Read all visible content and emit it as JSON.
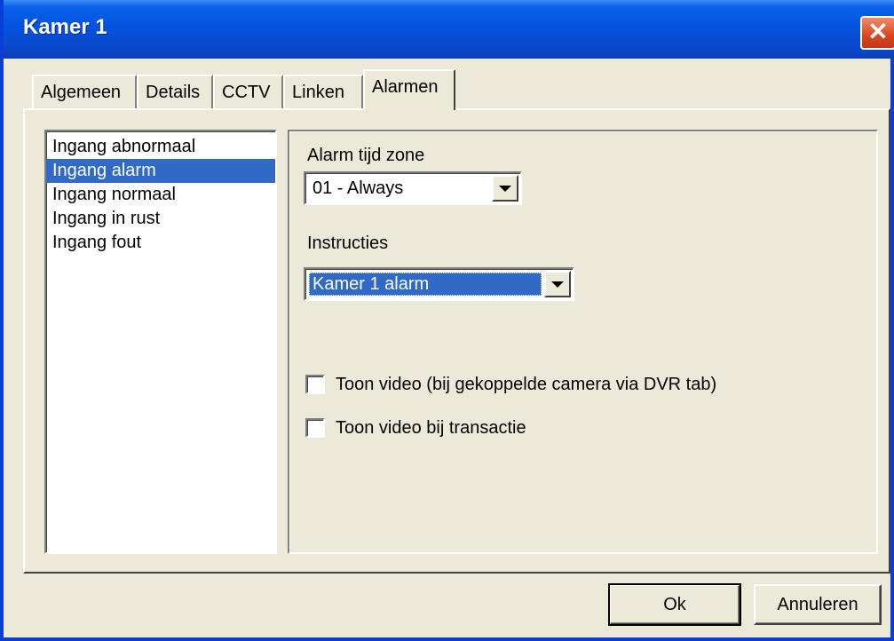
{
  "window": {
    "title": "Kamer 1",
    "close_symbol": "✕"
  },
  "tabs": [
    {
      "label": "Algemeen",
      "active": false
    },
    {
      "label": "Details",
      "active": false
    },
    {
      "label": "CCTV",
      "active": false
    },
    {
      "label": "Linken",
      "active": false
    },
    {
      "label": "Alarmen",
      "active": true
    }
  ],
  "event_list": {
    "items": [
      "Ingang abnormaal",
      "Ingang alarm",
      "Ingang normaal",
      "Ingang in rust",
      "Ingang fout"
    ],
    "selected_index": 1
  },
  "alarm_settings": {
    "time_zone_label": "Alarm tijd zone",
    "time_zone_value": "01 - Always",
    "instructions_label": "Instructies",
    "instructions_value": "Kamer 1 alarm",
    "show_video_label": "Toon video (bij gekoppelde camera via DVR tab)",
    "show_video_checked": false,
    "show_video_transaction_label": "Toon video bij transactie",
    "show_video_transaction_checked": false
  },
  "buttons": {
    "ok_label": "Ok",
    "cancel_label": "Annuleren"
  },
  "colors": {
    "titlebar": "#0553e0",
    "selection": "#316ac5",
    "face": "#ece9d8",
    "close": "#d8451f"
  }
}
